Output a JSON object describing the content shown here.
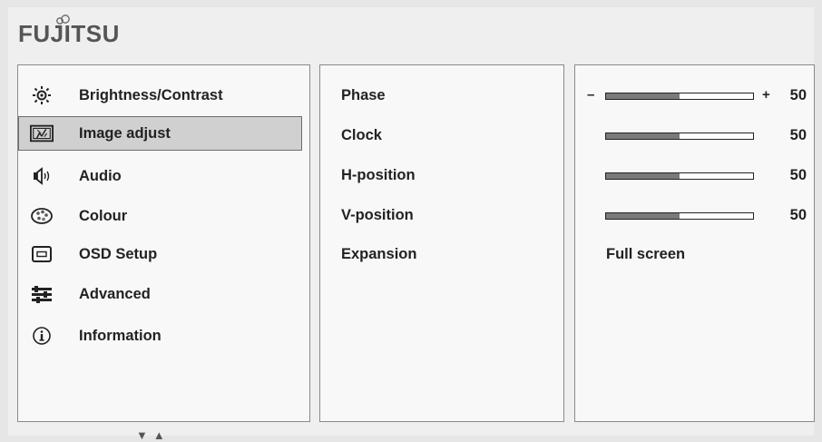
{
  "brand": {
    "logo_text": "FUJITSU"
  },
  "menu": {
    "items": [
      {
        "label": "Brightness/Contrast",
        "icon": "sun-icon",
        "selected": false
      },
      {
        "label": "Image adjust",
        "icon": "image-adjust-icon",
        "selected": true
      },
      {
        "label": "Audio",
        "icon": "speaker-icon",
        "selected": false
      },
      {
        "label": "Colour",
        "icon": "colour-palette-icon",
        "selected": false
      },
      {
        "label": "OSD Setup",
        "icon": "osd-monitor-icon",
        "selected": false
      },
      {
        "label": "Advanced",
        "icon": "advanced-settings-icon",
        "selected": false
      },
      {
        "label": "Information",
        "icon": "info-icon",
        "selected": false
      }
    ],
    "scroll_down": "▼",
    "scroll_up": "▲"
  },
  "settings": {
    "labels": [
      "Phase",
      "Clock",
      "H-position",
      "V-position",
      "Expansion"
    ],
    "phase": {
      "minus": "–",
      "plus": "+",
      "value": 50,
      "value_text": "50"
    },
    "clock": {
      "value": 50,
      "value_text": "50"
    },
    "h_position": {
      "value": 50,
      "value_text": "50"
    },
    "v_position": {
      "value": 50,
      "value_text": "50"
    },
    "expansion": {
      "value": "Full screen"
    }
  },
  "colors": {
    "background": "#e6e6e6",
    "panel": "#f8f8f8",
    "selected_row": "#d0d0d0",
    "bar_fill": "#7a7a7a"
  }
}
